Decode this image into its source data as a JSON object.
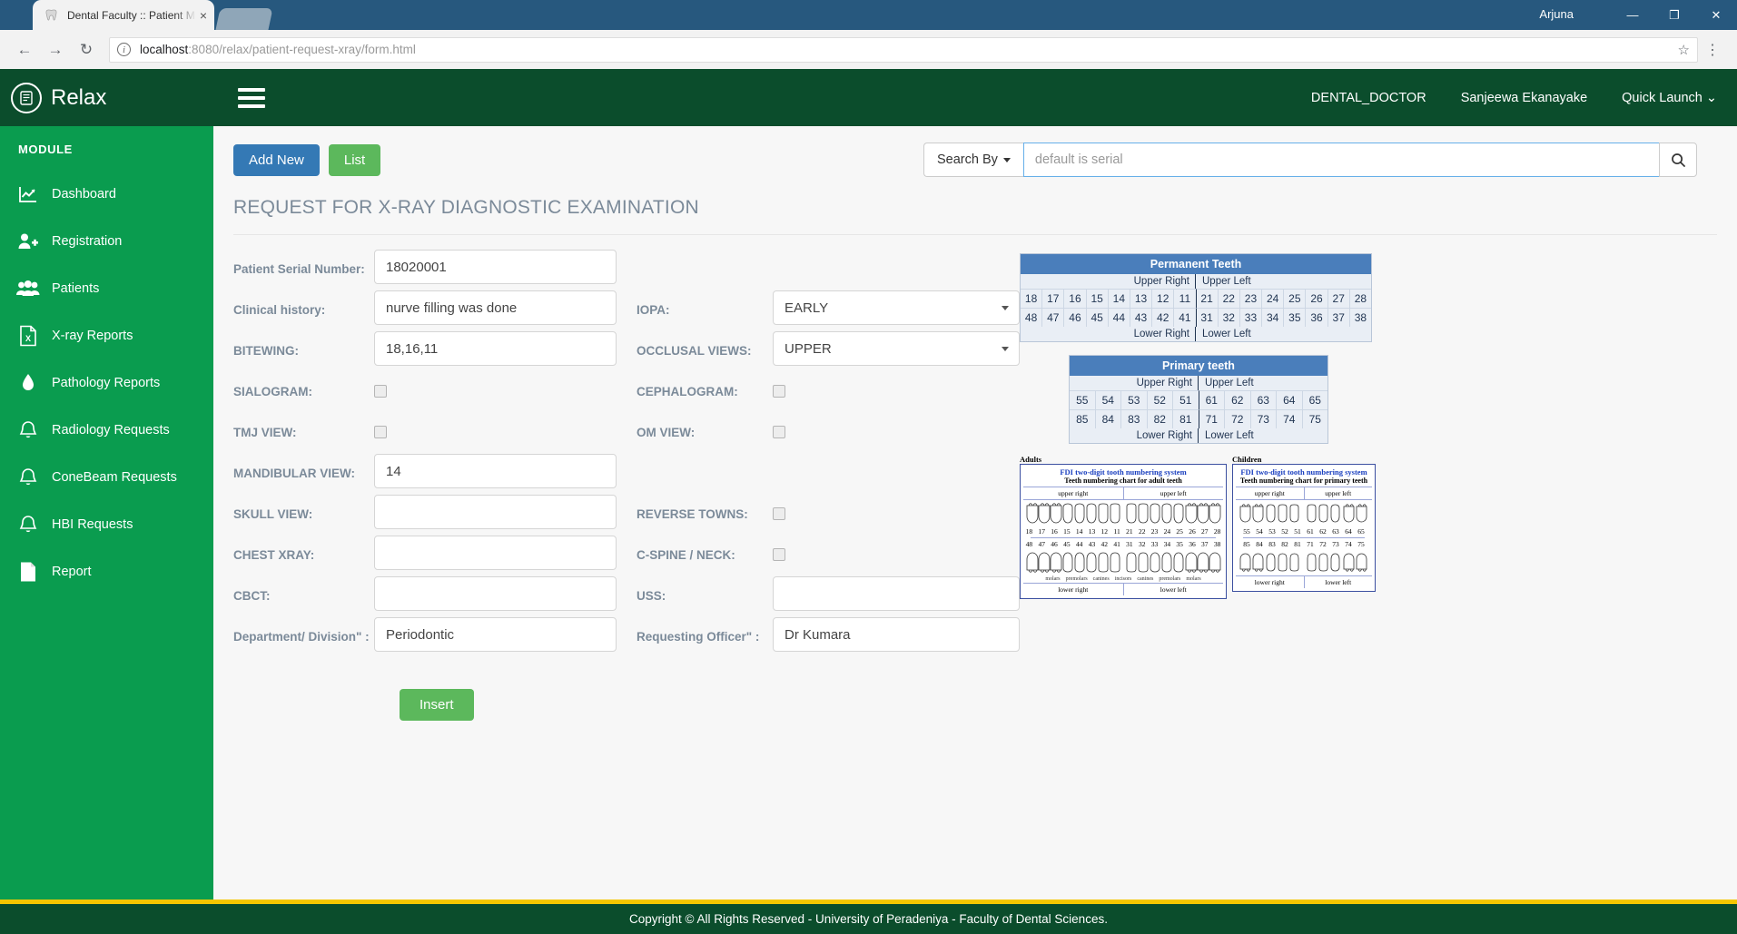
{
  "browser": {
    "tab_title": "Dental Faculty :: Patient M",
    "tab_close": "×",
    "back_icon": "←",
    "forward_icon": "→",
    "reload_icon": "↻",
    "url_host": "localhost",
    "url_rest": ":8080/relax/patient-request-xray/form.html",
    "star_icon": "☆",
    "menu_icon": "⋮",
    "window_user": "Arjuna",
    "minimize": "—",
    "maximize": "❐",
    "close": "✕"
  },
  "topbar": {
    "brand": "Relax",
    "nav": [
      {
        "label": "DENTAL_DOCTOR"
      },
      {
        "label": "Sanjeewa Ekanayake"
      },
      {
        "label": "Quick Launch ⌄"
      }
    ]
  },
  "sidebar": {
    "heading": "MODULE",
    "items": [
      {
        "label": "Dashboard",
        "icon": "chart-line-icon"
      },
      {
        "label": "Registration",
        "icon": "user-plus-icon"
      },
      {
        "label": "Patients",
        "icon": "users-icon"
      },
      {
        "label": "X-ray Reports",
        "icon": "file-x-icon"
      },
      {
        "label": "Pathology Reports",
        "icon": "droplet-icon"
      },
      {
        "label": "Radiology Requests",
        "icon": "bell-icon"
      },
      {
        "label": "ConeBeam Requests",
        "icon": "bell-icon"
      },
      {
        "label": "HBI Requests",
        "icon": "bell-icon"
      },
      {
        "label": "Report",
        "icon": "file-icon"
      }
    ]
  },
  "toolbar": {
    "add_new_label": "Add New",
    "list_label": "List",
    "search_by_label": "Search By",
    "search_placeholder": "default is serial",
    "search_value": "",
    "search_icon": "search-icon"
  },
  "page": {
    "title": "REQUEST FOR X-RAY DIAGNOSTIC EXAMINATION"
  },
  "form": {
    "rows": [
      {
        "left": {
          "label": "Patient Serial Number:",
          "type": "text",
          "value": "18020001"
        },
        "right": null
      },
      {
        "left": {
          "label": "Clinical history:",
          "type": "text",
          "value": "nurve filling was done"
        },
        "right": {
          "label": "IOPA:",
          "type": "select",
          "value": "EARLY"
        }
      },
      {
        "left": {
          "label": "BITEWING:",
          "type": "text",
          "value": "18,16,11"
        },
        "right": {
          "label": "OCCLUSAL VIEWS:",
          "type": "select",
          "value": "UPPER"
        }
      },
      {
        "left": {
          "label": "SIALOGRAM:",
          "type": "checkbox",
          "checked": false
        },
        "right": {
          "label": "CEPHALOGRAM:",
          "type": "checkbox",
          "checked": false
        }
      },
      {
        "left": {
          "label": "TMJ VIEW:",
          "type": "checkbox",
          "checked": false
        },
        "right": {
          "label": "OM VIEW:",
          "type": "checkbox",
          "checked": false
        }
      },
      {
        "left": {
          "label": "MANDIBULAR VIEW:",
          "type": "text",
          "value": "14"
        },
        "right": null
      },
      {
        "left": {
          "label": "SKULL VIEW:",
          "type": "text",
          "value": ""
        },
        "right": {
          "label": "REVERSE TOWNS:",
          "type": "checkbox",
          "checked": false
        }
      },
      {
        "left": {
          "label": "CHEST XRAY:",
          "type": "text",
          "value": ""
        },
        "right": {
          "label": "C-SPINE / NECK:",
          "type": "checkbox",
          "checked": false
        }
      },
      {
        "left": {
          "label": "CBCT:",
          "type": "text",
          "value": ""
        },
        "right": {
          "label": "USS:",
          "type": "text",
          "value": ""
        }
      },
      {
        "left": {
          "label": "Department/ Division\" :",
          "type": "text",
          "value": "Periodontic"
        },
        "right": {
          "label": "Requesting Officer\" :",
          "type": "text",
          "value": "Dr Kumara"
        }
      }
    ],
    "insert_label": "Insert"
  },
  "tooth_charts": {
    "permanent": {
      "title": "Permanent Teeth",
      "upper_right_label": "Upper Right",
      "upper_left_label": "Upper Left",
      "lower_right_label": "Lower Right",
      "lower_left_label": "Lower Left",
      "upper_right": [
        "18",
        "17",
        "16",
        "15",
        "14",
        "13",
        "12",
        "11"
      ],
      "upper_left": [
        "21",
        "22",
        "23",
        "24",
        "25",
        "26",
        "27",
        "28"
      ],
      "lower_right": [
        "48",
        "47",
        "46",
        "45",
        "44",
        "43",
        "42",
        "41"
      ],
      "lower_left": [
        "31",
        "32",
        "33",
        "34",
        "35",
        "36",
        "37",
        "38"
      ]
    },
    "primary": {
      "title": "Primary teeth",
      "upper_right_label": "Upper Right",
      "upper_left_label": "Upper Left",
      "lower_right_label": "Lower Right",
      "lower_left_label": "Lower Left",
      "upper_right": [
        "55",
        "54",
        "53",
        "52",
        "51"
      ],
      "upper_left": [
        "61",
        "62",
        "63",
        "64",
        "65"
      ],
      "lower_right": [
        "85",
        "84",
        "83",
        "82",
        "81"
      ],
      "lower_left": [
        "71",
        "72",
        "73",
        "74",
        "75"
      ]
    },
    "fdi_adults": {
      "caption": "Adults",
      "title1": "FDI two-digit tooth numbering system",
      "title2": "Teeth numbering chart for adult teeth",
      "upper_right": "upper right",
      "upper_left": "upper left",
      "lower_right": "lower right",
      "lower_left": "lower left",
      "row_upper": [
        "18",
        "17",
        "16",
        "15",
        "14",
        "13",
        "12",
        "11",
        "21",
        "22",
        "23",
        "24",
        "25",
        "26",
        "27",
        "28"
      ],
      "row_lower": [
        "48",
        "47",
        "46",
        "45",
        "44",
        "43",
        "42",
        "41",
        "31",
        "32",
        "33",
        "34",
        "35",
        "36",
        "37",
        "38"
      ],
      "group_labels": [
        "molars",
        "premolars",
        "canines",
        "incisors",
        "canines",
        "premolars",
        "molars"
      ]
    },
    "fdi_children": {
      "caption": "Children",
      "title1": "FDI two-digit tooth numbering system",
      "title2": "Teeth numbering chart for primary teeth",
      "upper_right": "upper right",
      "upper_left": "upper left",
      "lower_right": "lower right",
      "lower_left": "lower left",
      "row_upper": [
        "55",
        "54",
        "53",
        "52",
        "51",
        "61",
        "62",
        "63",
        "64",
        "65"
      ],
      "row_lower": [
        "85",
        "84",
        "83",
        "82",
        "81",
        "71",
        "72",
        "73",
        "74",
        "75"
      ]
    }
  },
  "footer": {
    "text": "Copyright © All Rights Reserved - University of Peradeniya - Faculty of Dental Sciences."
  },
  "colors": {
    "brand_green_dark": "#0b4d2c",
    "sidebar_green": "#0a9c4f",
    "primary_blue": "#3479b5",
    "success_green": "#5cb85c",
    "footer_accent": "#f5c600",
    "chart_header_blue": "#4a7ebb"
  }
}
